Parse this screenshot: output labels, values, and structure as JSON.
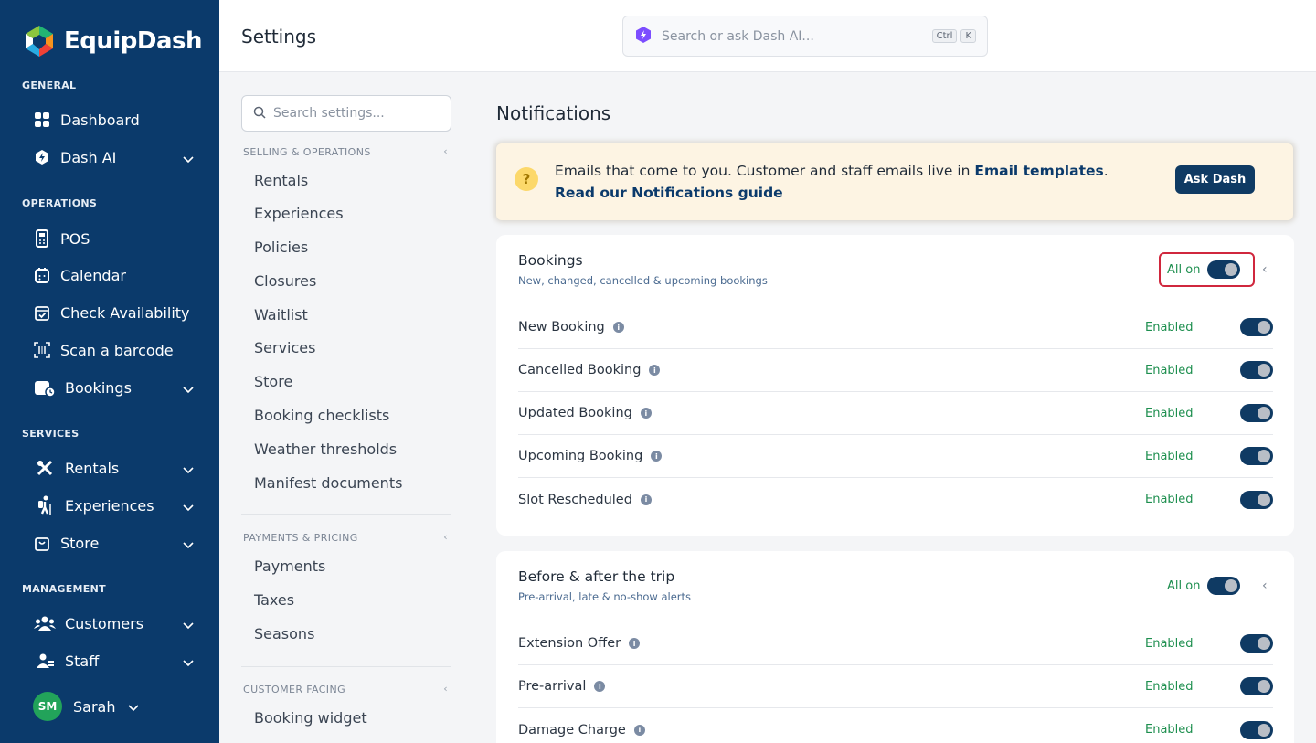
{
  "sidebar": {
    "brand": "EquipDash",
    "sections": {
      "general": "GENERAL",
      "operations": "OPERATIONS",
      "services": "SERVICES",
      "management": "MANAGEMENT"
    },
    "items": {
      "dashboard": "Dashboard",
      "dash_ai": "Dash AI",
      "pos": "POS",
      "calendar": "Calendar",
      "check_availability": "Check Availability",
      "scan_barcode": "Scan a barcode",
      "bookings": "Bookings",
      "rentals": "Rentals",
      "experiences": "Experiences",
      "store": "Store",
      "customers": "Customers",
      "staff": "Staff"
    },
    "user": {
      "initials": "SM",
      "name": "Sarah"
    }
  },
  "header": {
    "title": "Settings",
    "search_placeholder": "Search or ask Dash AI...",
    "kbd1": "Ctrl",
    "kbd2": "K"
  },
  "subnav": {
    "search_placeholder": "Search settings...",
    "groups": [
      {
        "label": "SELLING & OPERATIONS",
        "items": [
          "Rentals",
          "Experiences",
          "Policies",
          "Closures",
          "Waitlist",
          "Services",
          "Store",
          "Booking checklists",
          "Weather thresholds",
          "Manifest documents"
        ]
      },
      {
        "label": "PAYMENTS & PRICING",
        "items": [
          "Payments",
          "Taxes",
          "Seasons"
        ]
      },
      {
        "label": "CUSTOMER FACING",
        "items": [
          "Booking widget"
        ]
      }
    ]
  },
  "main": {
    "title": "Notifications",
    "banner": {
      "text": "Emails that come to you. Customer and staff emails live in ",
      "link1": "Email templates",
      "period": ".",
      "link2": "Read our Notifications guide",
      "button": "Ask Dash"
    },
    "cards": [
      {
        "title": "Bookings",
        "subtitle": "New, changed, cancelled & upcoming bookings",
        "all_on_label": "All on",
        "rows": [
          {
            "label": "New Booking",
            "status": "Enabled"
          },
          {
            "label": "Cancelled Booking",
            "status": "Enabled"
          },
          {
            "label": "Updated Booking",
            "status": "Enabled"
          },
          {
            "label": "Upcoming Booking",
            "status": "Enabled"
          },
          {
            "label": "Slot Rescheduled",
            "status": "Enabled"
          }
        ]
      },
      {
        "title": "Before & after the trip",
        "subtitle": "Pre-arrival, late & no-show alerts",
        "all_on_label": "All on",
        "rows": [
          {
            "label": "Extension Offer",
            "status": "Enabled"
          },
          {
            "label": "Pre-arrival",
            "status": "Enabled"
          },
          {
            "label": "Damage Charge",
            "status": "Enabled"
          }
        ]
      }
    ]
  },
  "colors": {
    "sidebar_bg": "#0b3a6b",
    "accent_dark": "#0f3a63",
    "enabled_green": "#1e8f4f",
    "highlight_red": "#d0273d",
    "banner_bg": "#fdf4e3"
  }
}
